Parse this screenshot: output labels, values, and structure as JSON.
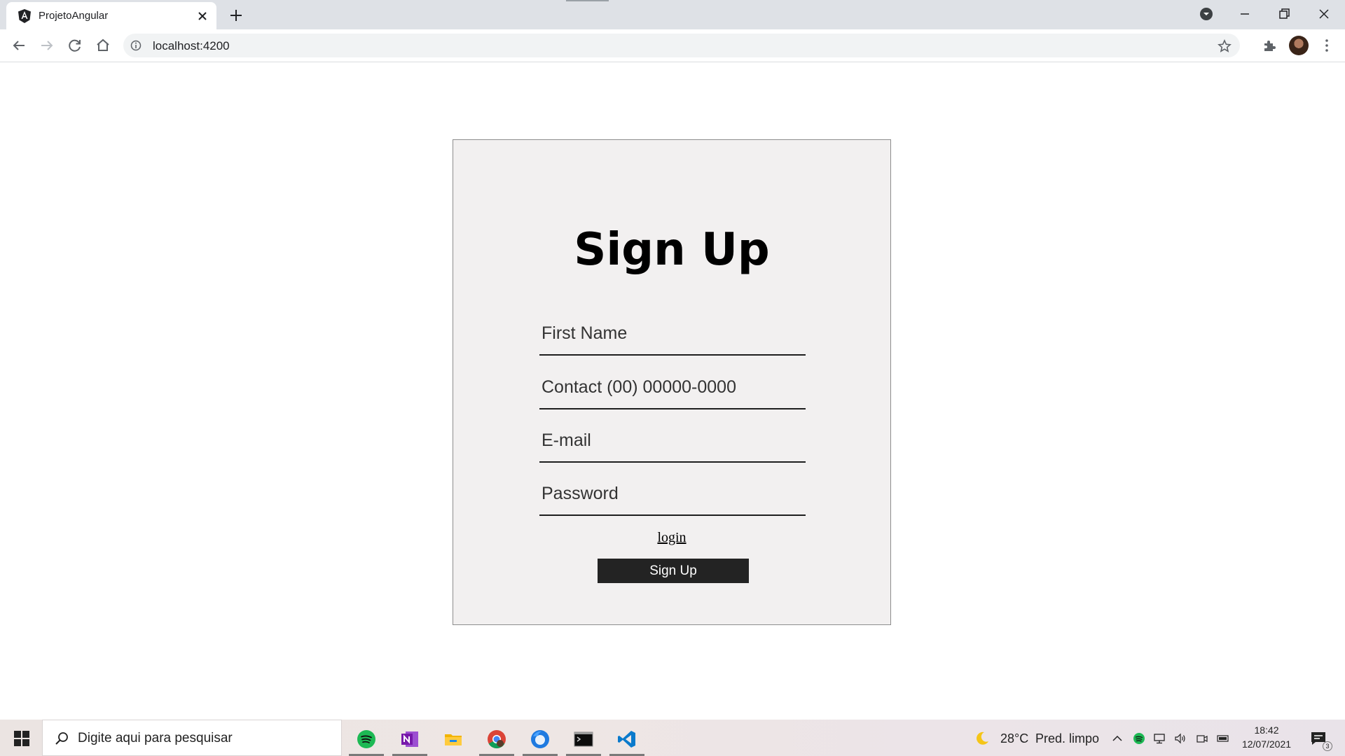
{
  "browser": {
    "tab_title": "ProjetoAngular",
    "url": "localhost:4200"
  },
  "form": {
    "title": "Sign Up",
    "fields": {
      "first_name_placeholder": "First Name",
      "contact_placeholder": "Contact (00) 00000-0000",
      "email_placeholder": "E-mail",
      "password_placeholder": "Password"
    },
    "login_link": "login",
    "submit_label": "Sign Up"
  },
  "taskbar": {
    "search_placeholder": "Digite aqui para pesquisar",
    "weather_temp": "28°C",
    "weather_desc": "Pred. limpo",
    "time": "18:42",
    "date": "12/07/2021",
    "notification_count": "3"
  },
  "icons": {
    "tab": [
      "angular-icon",
      "close-icon",
      "plus-icon"
    ],
    "toolbar": [
      "back-icon",
      "forward-icon",
      "reload-icon",
      "home-icon",
      "info-icon",
      "star-icon",
      "extensions-icon",
      "avatar",
      "menu-icon"
    ],
    "taskbar_apps": [
      "spotify-icon",
      "onenote-icon",
      "file-explorer-icon",
      "chrome-icon",
      "firefox-icon",
      "terminal-icon",
      "vscode-icon"
    ]
  }
}
